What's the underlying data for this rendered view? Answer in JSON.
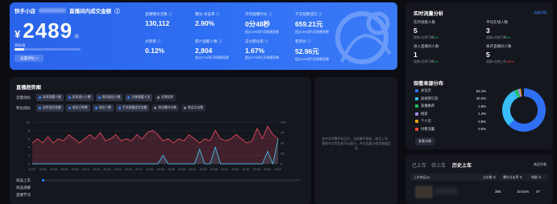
{
  "hero": {
    "brand": "快手小店",
    "title_suffix": "直播间内成交金额",
    "currency": "¥",
    "amount": "2489",
    "amount_unit": "元",
    "progress_label": "目标值",
    "progress_fraction": 0.15,
    "button_label": "设置目标 >",
    "metrics": [
      {
        "label": "直播曝光次数 ⓘ",
        "value": "130,112",
        "sub": ""
      },
      {
        "label": "曝光-点击率 ⓘ",
        "value": "2.90%",
        "sub": ""
      },
      {
        "label": "次均观看时长 ⓘ",
        "value": "0分48秒",
        "sub": "超过23%同行同规模直播"
      },
      {
        "label": "千次观看成交 ⓘ",
        "value": "659.21元",
        "sub": "超过59%同行同规模直播"
      },
      {
        "label": "点赞率 ⓘ",
        "value": "0.12%",
        "sub": ""
      },
      {
        "label": "累计观看人数 ⓘ",
        "value": "2,804",
        "sub": "超过37%同行同规模直播"
      },
      {
        "label": "支付转化率 ⓘ",
        "value": "1.67%",
        "sub": "超过47%同行同规模直播"
      },
      {
        "label": "客单价 ⓘ",
        "value": "52.96元",
        "sub": "超过63%同行同规模直播"
      }
    ]
  },
  "trend": {
    "title": "直播趋势图",
    "row1_label": "流量指标",
    "row1_chips": [
      "实时观看人数",
      "实时进入人数",
      "实时退出人数",
      "分钟观看人次",
      "近期同步"
    ],
    "row2_label": "转化指标",
    "row2_chips": [
      "实时成交金额",
      "成交订单数",
      "成交人数",
      "千次观看成交金额",
      "商品曝光次数",
      "商品点击数"
    ],
    "bottom": [
      "商品上车",
      "商品讲解",
      "直播节点"
    ]
  },
  "chart_data": {
    "type": "line",
    "x": [
      "21:57",
      "22:00",
      "22:03",
      "22:06",
      "22:09",
      "22:12",
      "22:15",
      "22:18",
      "22:21",
      "22:24",
      "22:27",
      "22:30",
      "22:33",
      "22:36",
      "22:39",
      "22:42",
      "22:45",
      "22:48",
      "22:51",
      "22:54",
      "22:57",
      "23:00",
      "23:03",
      "23:07"
    ],
    "ylim": [
      0,
      10
    ],
    "y2lim": [
      0,
      100
    ],
    "yticks": [
      "0",
      "2",
      "4",
      "6",
      "8",
      "10"
    ],
    "y2ticks": [
      "0",
      "25",
      "50",
      "75",
      "100"
    ],
    "series": [
      {
        "color": "#e0455e",
        "values": [
          5,
          6,
          5,
          6.5,
          5,
          6,
          5.5,
          7,
          6,
          5,
          6,
          7,
          6,
          7.5,
          5.5,
          6,
          7,
          5.5,
          6,
          5.5,
          7,
          6,
          7.5,
          8,
          7,
          5.5,
          6,
          5,
          6,
          5.5,
          7,
          6,
          5,
          6,
          5.5,
          8,
          6,
          5.5,
          6,
          7,
          6,
          5,
          5.5,
          8.5,
          6,
          9,
          7,
          6
        ]
      },
      {
        "color": "#4fb3d9",
        "values": [
          0,
          0,
          0,
          0,
          0,
          0,
          0,
          0,
          0,
          0,
          0,
          0,
          0,
          0,
          0,
          0,
          0,
          0,
          0,
          0,
          0,
          0,
          0,
          0,
          0,
          2,
          0,
          0,
          0,
          0,
          0,
          0,
          3.5,
          0,
          0,
          4,
          0,
          0,
          0,
          0,
          0,
          0,
          0,
          0,
          0,
          3,
          0,
          6
        ]
      }
    ]
  },
  "empty_panel": {
    "message": "选中实时事件标记后，全部事件指标、商品上车、营销节点等信息可以展示，并在此展示相关数据信息"
  },
  "realtime": {
    "title": "实时流量分析",
    "link": "流量详情",
    "cells": [
      {
        "label": "实时观看人数",
        "value": "5",
        "sub_prefix": "较前1分钟下降",
        "sub_value": "0%",
        "trend": "up"
      },
      {
        "label": "平均在线人数",
        "value": "3",
        "sub_prefix": "较前1分钟下降",
        "sub_value": "0%",
        "trend": "up"
      },
      {
        "label": "进入直播间人数",
        "value": "1",
        "sub_prefix": "较前1分钟下降",
        "sub_value": "0%",
        "trend": "up"
      },
      {
        "label": "离开直播间人数",
        "value": "5",
        "sub_prefix": "较前1分钟上升",
        "sub_value": "400%",
        "trend": "down"
      }
    ],
    "source_title": "观看来源分布",
    "sources": [
      {
        "name": "关注页",
        "pct": "62.4%",
        "color": "#2f6ff4"
      },
      {
        "name": "短视频引流",
        "pct": "30.3%",
        "color": "#38bdf8"
      },
      {
        "name": "直播推荐",
        "pct": "2.8%",
        "color": "#22c55e"
      },
      {
        "name": "搜索",
        "pct": "1.4%",
        "color": "#a78bfa"
      },
      {
        "name": "个人页",
        "pct": "0.8%",
        "color": "#f59e0b"
      },
      {
        "name": "付费流量",
        "pct": "0.0%",
        "color": "#ef4444"
      }
    ],
    "source_button": "查看详情"
  },
  "cart": {
    "tabs": [
      "已上车",
      "待上车",
      "历史上车"
    ],
    "active_tab": 2,
    "link": "商品列表",
    "headers": [
      "上车商品(3)",
      "点击数 ⇅",
      "曝光点击率 ⇅",
      "销量 ⇅"
    ],
    "rows": [
      {
        "clicks": "384",
        "ctr": "10.81%",
        "sales": "47"
      }
    ]
  }
}
